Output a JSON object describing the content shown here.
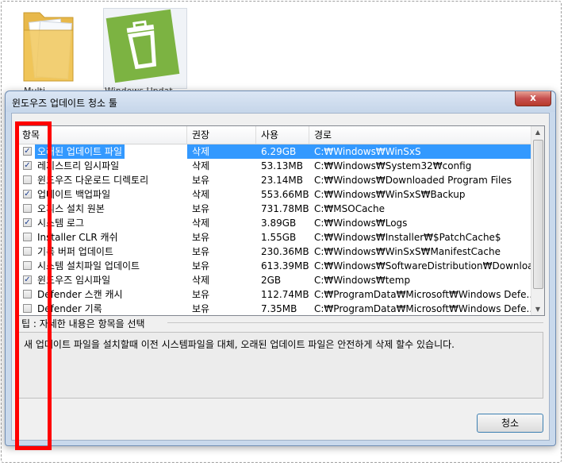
{
  "desktop": {
    "icon1_caption": "Multi...",
    "icon2_caption": "Windows Updat..."
  },
  "window": {
    "title": "윈도우즈 업데이트 청소 툴",
    "close_label": "x"
  },
  "list": {
    "columns": [
      "항목",
      "권장",
      "사용",
      "경로"
    ],
    "rows": [
      {
        "name": "오래된 업데이트 파일",
        "rec": "삭제",
        "size": "6.29GB",
        "path": "C:₩Windows₩WinSxS",
        "checked": true,
        "selected": true
      },
      {
        "name": "레지스트리 임시파일",
        "rec": "삭제",
        "size": "53.13MB",
        "path": "C:₩Windows₩System32₩config",
        "checked": true
      },
      {
        "name": "윈도우즈 다운로드 디렉토리",
        "rec": "보유",
        "size": "23.14MB",
        "path": "C:₩Windows₩Downloaded Program Files",
        "checked": false
      },
      {
        "name": "업데이트 백업파일",
        "rec": "삭제",
        "size": "553.66MB",
        "path": "C:₩Windows₩WinSxS₩Backup",
        "checked": true
      },
      {
        "name": "오피스 설치 원본",
        "rec": "보유",
        "size": "731.78MB",
        "path": "C:₩MSOCache",
        "checked": false
      },
      {
        "name": "시스템 로그",
        "rec": "삭제",
        "size": "3.89GB",
        "path": "C:₩Windows₩Logs",
        "checked": true
      },
      {
        "name": "Installer CLR 캐쉬",
        "rec": "보유",
        "size": "1.55GB",
        "path": "C:₩Windows₩Installer₩$PatchCache$",
        "checked": false
      },
      {
        "name": "기록 버퍼 업데이트",
        "rec": "보유",
        "size": "230.36MB",
        "path": "C:₩Windows₩WinSxS₩ManifestCache",
        "checked": false
      },
      {
        "name": "시스템 설치파일 업데이트",
        "rec": "보유",
        "size": "613.39MB",
        "path": "C:₩Windows₩SoftwareDistribution₩Download",
        "checked": false
      },
      {
        "name": "윈도우즈 임시파일",
        "rec": "삭제",
        "size": "2GB",
        "path": "C:₩Windows₩temp",
        "checked": true
      },
      {
        "name": "Defender 스캔 캐시",
        "rec": "보유",
        "size": "112.74MB",
        "path": "C:₩ProgramData₩Microsoft₩Windows Defe...",
        "checked": false
      },
      {
        "name": "Defender 기록",
        "rec": "보유",
        "size": "7.35MB",
        "path": "C:₩ProgramData₩Microsoft₩Windows Defe...",
        "checked": false
      }
    ]
  },
  "tip": {
    "label": "팁 : 자세한 내용은 항목을 선택",
    "text": "새 업데이트 파일을 설치할때 이전 시스템파일을 대체, 오래된 업데이트 파일은 안전하게 삭제 할수 있습니다."
  },
  "buttons": {
    "clean": "청소"
  },
  "colors": {
    "highlight": "#ff0000",
    "selection": "#3399ff"
  }
}
